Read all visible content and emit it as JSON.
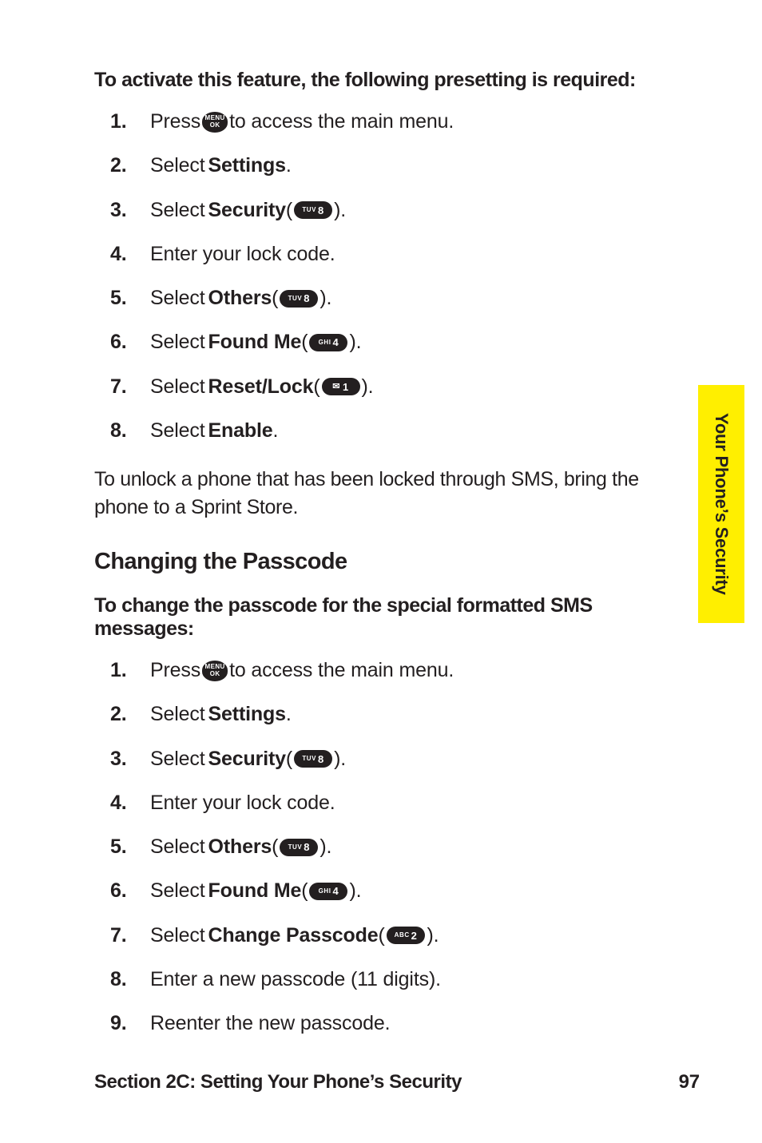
{
  "intro1": "To activate this feature, the following presetting is required:",
  "s1": {
    "i1a": "Press ",
    "i1b": " to access the main menu.",
    "i2a": "Select ",
    "i2b": "Settings",
    "i2c": ".",
    "i3a": "Select ",
    "i3b": "Security",
    "i3c": " ( ",
    "i3d": " ).",
    "i4": "Enter your lock code.",
    "i5a": "Select ",
    "i5b": "Others",
    "i5c": " ( ",
    "i5d": " ).",
    "i6a": "Select ",
    "i6b": "Found Me",
    "i6c": " ( ",
    "i6d": " ).",
    "i7a": "Select ",
    "i7b": "Reset/Lock",
    "i7c": " ( ",
    "i7d": " ).",
    "i8a": "Select ",
    "i8b": "Enable",
    "i8c": "."
  },
  "bodypara": "To unlock a phone that has been locked through SMS, bring the phone to a Sprint Store.",
  "subheading": "Changing the Passcode",
  "intro2": "To change the passcode for the special formatted SMS messages:",
  "s2": {
    "i1a": "Press ",
    "i1b": " to access the main menu.",
    "i2a": "Select ",
    "i2b": "Settings",
    "i2c": ".",
    "i3a": "Select ",
    "i3b": "Security",
    "i3c": " ( ",
    "i3d": " ).",
    "i4": "Enter your lock code.",
    "i5a": "Select ",
    "i5b": "Others",
    "i5c": " ( ",
    "i5d": " ).",
    "i6a": "Select ",
    "i6b": "Found Me",
    "i6c": " ( ",
    "i6d": " ).",
    "i7a": "Select ",
    "i7b": "Change Passcode",
    "i7c": " ( ",
    "i7d": " ).",
    "i8": "Enter a new passcode (11 digits).",
    "i9": "Reenter the new passcode."
  },
  "keys": {
    "menu_l1": "MENU",
    "menu_l2": "OK",
    "tuv": "TUV",
    "d8": "8",
    "ghi": "GHI",
    "d4": "4",
    "d1": "1",
    "abc": "ABC",
    "d2": "2",
    "mail": "✉"
  },
  "footer_left": "Section 2C: Setting Your Phone’s Security",
  "footer_right": "97",
  "side_tab": "Your Phone’s Security"
}
